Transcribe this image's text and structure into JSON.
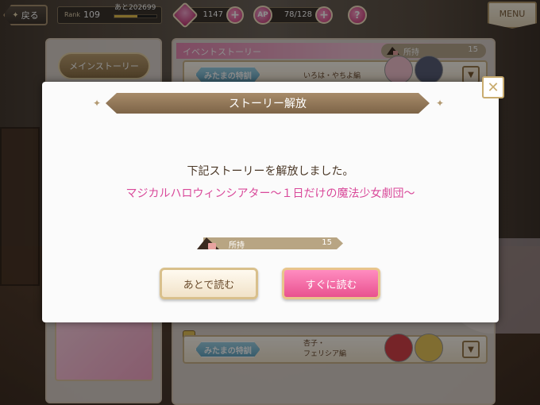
{
  "topbar": {
    "back_label": "戻る",
    "rank_label": "Rank",
    "rank_value": "109",
    "rank_next": "あと202699",
    "rank_progress": 0.55,
    "gems_value": "1147",
    "ap_label": "AP",
    "ap_value": "78/128",
    "help_label": "?",
    "menu_label": "MENU"
  },
  "left_panel": {
    "main_story_label": "メインストーリー"
  },
  "right_panel": {
    "event_header": "イベントストーリー",
    "owned_label": "所持",
    "owned_value": "15",
    "stories": [
      {
        "title": "みたまの特訓",
        "subtitle": "いろは・やちよ編"
      },
      {
        "title": "みたまの特訓",
        "subtitle_line1": "杏子・",
        "subtitle_line2": "フェリシア編"
      }
    ]
  },
  "dialog": {
    "title": "ストーリー解放",
    "message": "下記ストーリーを解放しました。",
    "story_name": "マジカルハロウィンシアター～１日だけの魔法少女劇団～",
    "owned_label": "所持",
    "owned_value": "15",
    "later_button": "あとで読む",
    "now_button": "すぐに読む"
  },
  "colors": {
    "accent_pink": "#e9528f",
    "title_brown": "#7d6447",
    "story_name_pink": "#d9499a"
  }
}
